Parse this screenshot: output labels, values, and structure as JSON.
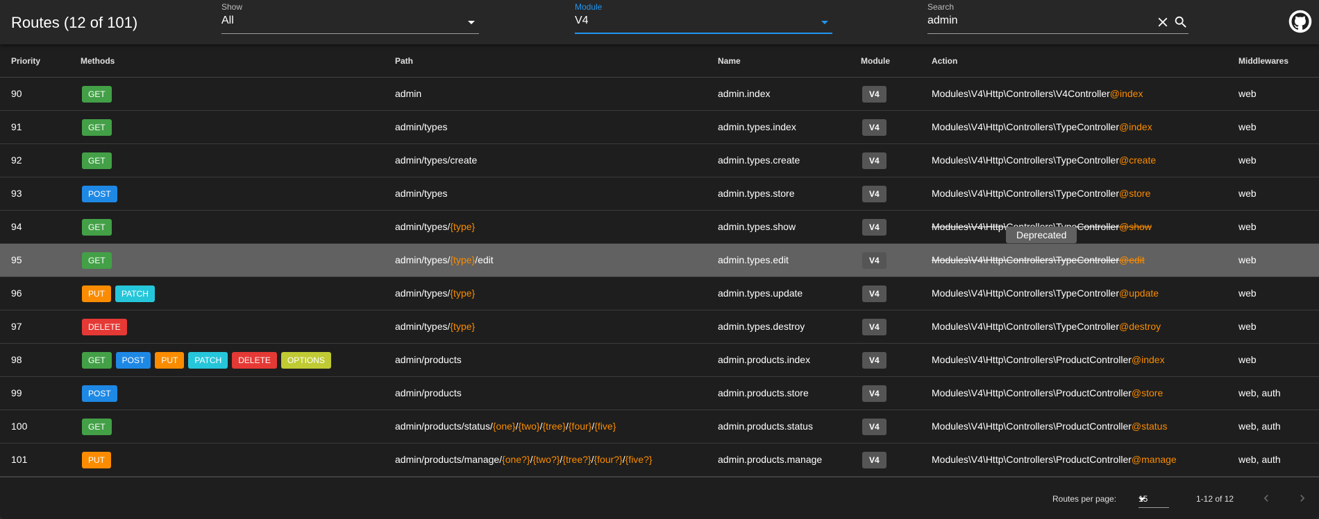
{
  "toolbar": {
    "title": "Routes (12 of 101)",
    "show": {
      "label": "Show",
      "value": "All"
    },
    "module": {
      "label": "Module",
      "value": "V4"
    },
    "search": {
      "label": "Search",
      "value": "admin"
    },
    "icons": [
      "close-icon",
      "search-icon",
      "github-icon"
    ]
  },
  "columns": {
    "priority": "Priority",
    "methods": "Methods",
    "path": "Path",
    "name": "Name",
    "module": "Module",
    "action": "Action",
    "middlewares": "Middlewares"
  },
  "colors": {
    "GET": "#43a047",
    "POST": "#1e88e5",
    "PUT": "#fb8c00",
    "PATCH": "#26c6da",
    "DELETE": "#e53935",
    "OPTIONS": "#c0ca33",
    "param": "#fb8c00",
    "accent": "#2196f3"
  },
  "rows": [
    {
      "priority": "90",
      "methods": [
        "GET"
      ],
      "path": [
        [
          "admin",
          false
        ]
      ],
      "name": "admin.index",
      "module": "V4",
      "controller": "Modules\\V4\\Http\\Controllers\\V4Controller",
      "method": "@index",
      "middlewares": "web",
      "deprecated": false
    },
    {
      "priority": "91",
      "methods": [
        "GET"
      ],
      "path": [
        [
          "admin/types",
          false
        ]
      ],
      "name": "admin.types.index",
      "module": "V4",
      "controller": "Modules\\V4\\Http\\Controllers\\TypeController",
      "method": "@index",
      "middlewares": "web",
      "deprecated": false
    },
    {
      "priority": "92",
      "methods": [
        "GET"
      ],
      "path": [
        [
          "admin/types/create",
          false
        ]
      ],
      "name": "admin.types.create",
      "module": "V4",
      "controller": "Modules\\V4\\Http\\Controllers\\TypeController",
      "method": "@create",
      "middlewares": "web",
      "deprecated": false
    },
    {
      "priority": "93",
      "methods": [
        "POST"
      ],
      "path": [
        [
          "admin/types",
          false
        ]
      ],
      "name": "admin.types.store",
      "module": "V4",
      "controller": "Modules\\V4\\Http\\Controllers\\TypeController",
      "method": "@store",
      "middlewares": "web",
      "deprecated": false
    },
    {
      "priority": "94",
      "methods": [
        "GET"
      ],
      "path": [
        [
          "admin/types/",
          false
        ],
        [
          "{type}",
          true
        ]
      ],
      "name": "admin.types.show",
      "module": "V4",
      "controller": "Modules\\V4\\Http\\Controllers\\TypeController",
      "method": "@show",
      "middlewares": "web",
      "deprecated": true
    },
    {
      "priority": "95",
      "methods": [
        "GET"
      ],
      "path": [
        [
          "admin/types/",
          false
        ],
        [
          "{type}",
          true
        ],
        [
          "/edit",
          false
        ]
      ],
      "name": "admin.types.edit",
      "module": "V4",
      "controller": "Modules\\V4\\Http\\Controllers\\TypeController",
      "method": "@edit",
      "middlewares": "web",
      "deprecated": true,
      "highlight": true
    },
    {
      "priority": "96",
      "methods": [
        "PUT",
        "PATCH"
      ],
      "path": [
        [
          "admin/types/",
          false
        ],
        [
          "{type}",
          true
        ]
      ],
      "name": "admin.types.update",
      "module": "V4",
      "controller": "Modules\\V4\\Http\\Controllers\\TypeController",
      "method": "@update",
      "middlewares": "web",
      "deprecated": false
    },
    {
      "priority": "97",
      "methods": [
        "DELETE"
      ],
      "path": [
        [
          "admin/types/",
          false
        ],
        [
          "{type}",
          true
        ]
      ],
      "name": "admin.types.destroy",
      "module": "V4",
      "controller": "Modules\\V4\\Http\\Controllers\\TypeController",
      "method": "@destroy",
      "middlewares": "web",
      "deprecated": false
    },
    {
      "priority": "98",
      "methods": [
        "GET",
        "POST",
        "PUT",
        "PATCH",
        "DELETE",
        "OPTIONS"
      ],
      "path": [
        [
          "admin/products",
          false
        ]
      ],
      "name": "admin.products.index",
      "module": "V4",
      "controller": "Modules\\V4\\Http\\Controllers\\ProductController",
      "method": "@index",
      "middlewares": "web",
      "deprecated": false
    },
    {
      "priority": "99",
      "methods": [
        "POST"
      ],
      "path": [
        [
          "admin/products",
          false
        ]
      ],
      "name": "admin.products.store",
      "module": "V4",
      "controller": "Modules\\V4\\Http\\Controllers\\ProductController",
      "method": "@store",
      "middlewares": "web, auth",
      "deprecated": false
    },
    {
      "priority": "100",
      "methods": [
        "GET"
      ],
      "path": [
        [
          "admin/products/status/",
          false
        ],
        [
          "{one}",
          true
        ],
        [
          "/",
          false
        ],
        [
          "{two}",
          true
        ],
        [
          "/",
          false
        ],
        [
          "{tree}",
          true
        ],
        [
          "/",
          false
        ],
        [
          "{four}",
          true
        ],
        [
          "/",
          false
        ],
        [
          "{five}",
          true
        ]
      ],
      "name": "admin.products.status",
      "module": "V4",
      "controller": "Modules\\V4\\Http\\Controllers\\ProductController",
      "method": "@status",
      "middlewares": "web, auth",
      "deprecated": false
    },
    {
      "priority": "101",
      "methods": [
        "PUT"
      ],
      "path": [
        [
          "admin/products/manage/",
          false
        ],
        [
          "{one?}",
          true
        ],
        [
          "/",
          false
        ],
        [
          "{two?}",
          true
        ],
        [
          "/",
          false
        ],
        [
          "{tree?}",
          true
        ],
        [
          "/",
          false
        ],
        [
          "{four?}",
          true
        ],
        [
          "/",
          false
        ],
        [
          "{five?}",
          true
        ]
      ],
      "name": "admin.products.manage",
      "module": "V4",
      "controller": "Modules\\V4\\Http\\Controllers\\ProductController",
      "method": "@manage",
      "middlewares": "web, auth",
      "deprecated": false
    }
  ],
  "tooltip": "Deprecated",
  "footer": {
    "rows_per_page_label": "Routes per page:",
    "rows_per_page": "15",
    "range": "1-12 of 12"
  }
}
